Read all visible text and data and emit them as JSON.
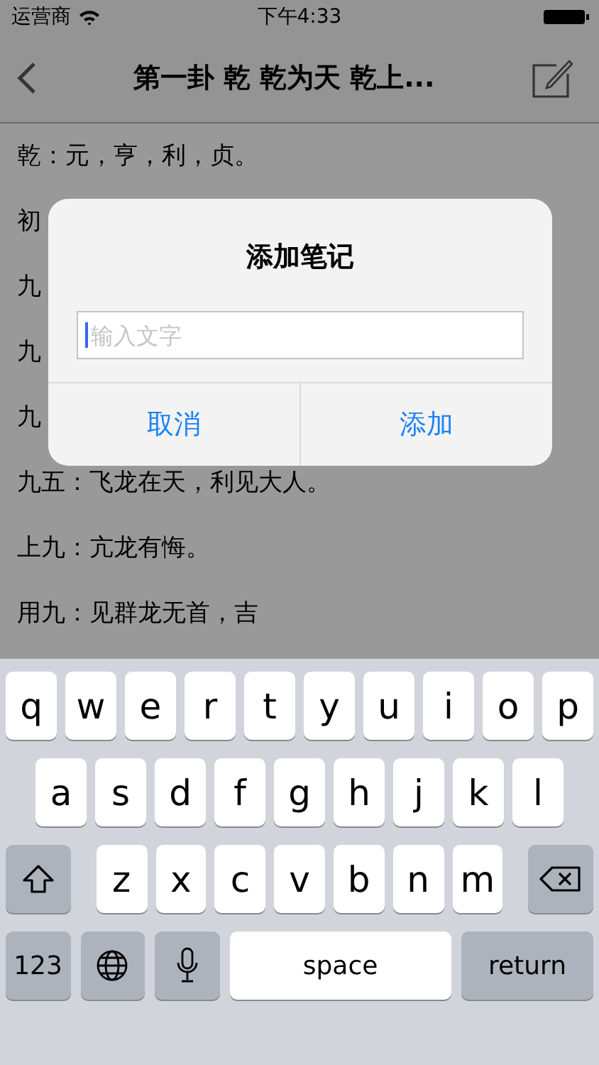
{
  "status_bar": {
    "carrier": "运营商",
    "time": "下午4:33"
  },
  "nav": {
    "title": "第一卦 乾 乾为天 乾上..."
  },
  "lines": [
    "乾：元，亨，利，贞。",
    "初",
    "九",
    "九",
    "九",
    "九五：飞龙在天，利见大人。",
    "上九：亢龙有悔。",
    "用九：见群龙无首，吉"
  ],
  "dialog": {
    "title": "添加笔记",
    "input": {
      "placeholder": "输入文字"
    },
    "buttons": [
      "取消",
      "添加"
    ]
  },
  "keyboard": {
    "rows": [
      {
        "keys": [
          {
            "kind": "letter",
            "label": "q"
          },
          {
            "kind": "letter",
            "label": "w"
          },
          {
            "kind": "letter",
            "label": "e"
          },
          {
            "kind": "letter",
            "label": "r"
          },
          {
            "kind": "letter",
            "label": "t"
          },
          {
            "kind": "letter",
            "label": "y"
          },
          {
            "kind": "letter",
            "label": "u"
          },
          {
            "kind": "letter",
            "label": "i"
          },
          {
            "kind": "letter",
            "label": "o"
          },
          {
            "kind": "letter",
            "label": "p"
          }
        ]
      },
      {
        "keys": [
          {
            "kind": "letter",
            "label": "a"
          },
          {
            "kind": "letter",
            "label": "s"
          },
          {
            "kind": "letter",
            "label": "d"
          },
          {
            "kind": "letter",
            "label": "f"
          },
          {
            "kind": "letter",
            "label": "g"
          },
          {
            "kind": "letter",
            "label": "h"
          },
          {
            "kind": "letter",
            "label": "j"
          },
          {
            "kind": "letter",
            "label": "k"
          },
          {
            "kind": "letter",
            "label": "l"
          }
        ]
      },
      {
        "keys": [
          {
            "kind": "shift"
          },
          {
            "kind": "letter",
            "label": "z"
          },
          {
            "kind": "letter",
            "label": "x"
          },
          {
            "kind": "letter",
            "label": "c"
          },
          {
            "kind": "letter",
            "label": "v"
          },
          {
            "kind": "letter",
            "label": "b"
          },
          {
            "kind": "letter",
            "label": "n"
          },
          {
            "kind": "letter",
            "label": "m"
          },
          {
            "kind": "delete"
          }
        ]
      },
      {
        "keys": [
          {
            "kind": "function",
            "label": "123"
          },
          {
            "kind": "globe"
          },
          {
            "kind": "mic"
          },
          {
            "kind": "space",
            "label": "space"
          },
          {
            "kind": "function",
            "label": "return"
          }
        ]
      }
    ]
  }
}
